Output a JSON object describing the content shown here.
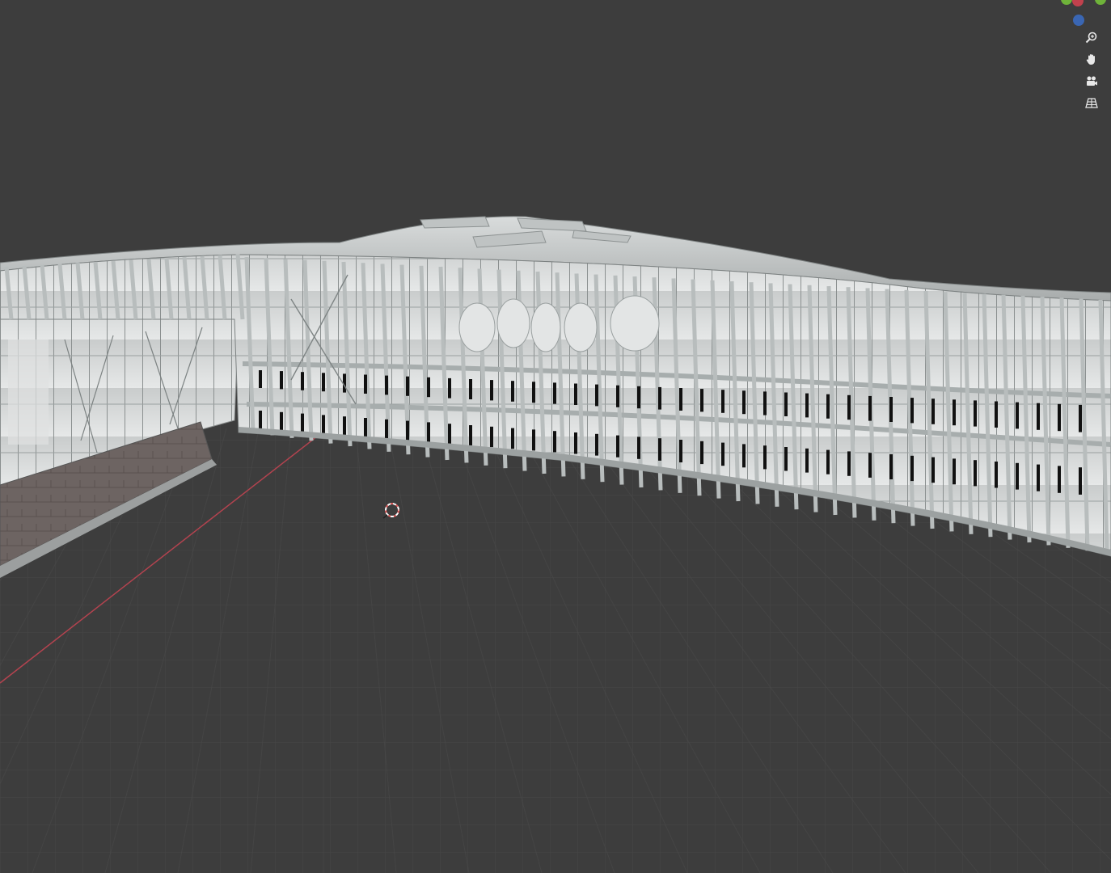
{
  "viewport": {
    "background": "#3d3d3d",
    "grid_color": "#4a4a4a",
    "x_axis_color": "#b3434f",
    "cursor_color": "#e05a5a"
  },
  "navigation_gizmo": {
    "axes": [
      {
        "name": "y-axis-dot",
        "color": "#6fb33a"
      },
      {
        "name": "x-axis-dot",
        "color": "#c0414d"
      },
      {
        "name": "y-axis-dot-2",
        "color": "#6fb33a"
      },
      {
        "name": "z-axis-dot",
        "color": "#3a66b3"
      }
    ]
  },
  "nav_tools": [
    {
      "name": "zoom-icon"
    },
    {
      "name": "pan-hand-icon"
    },
    {
      "name": "camera-view-icon"
    },
    {
      "name": "perspective-grid-icon"
    }
  ]
}
